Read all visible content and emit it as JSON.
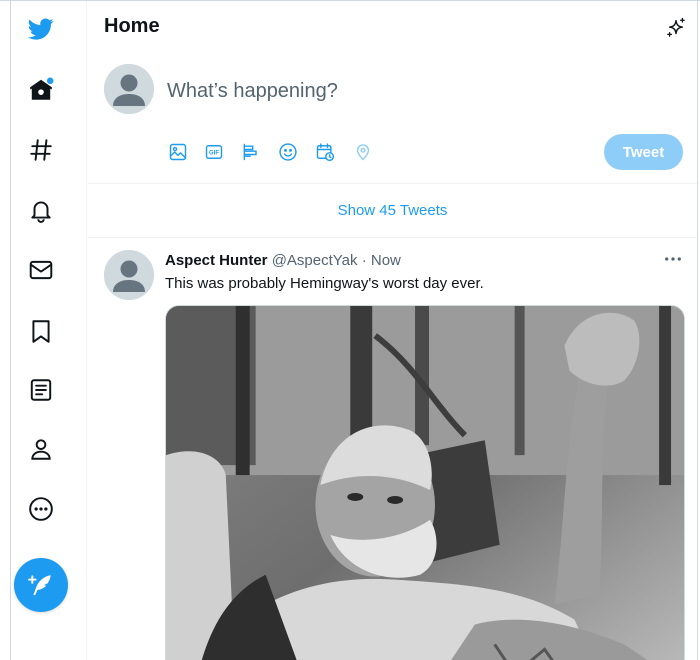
{
  "header": {
    "title": "Home"
  },
  "sidebar": {
    "items": [
      {
        "icon": "twitter-logo-icon"
      },
      {
        "icon": "home-icon",
        "has_notification_dot": true
      },
      {
        "icon": "explore-hashtag-icon"
      },
      {
        "icon": "notifications-bell-icon"
      },
      {
        "icon": "messages-envelope-icon"
      },
      {
        "icon": "bookmarks-icon"
      },
      {
        "icon": "lists-icon"
      },
      {
        "icon": "profile-icon"
      },
      {
        "icon": "more-ellipsis-icon"
      }
    ],
    "compose_icon": "compose-tweet-feather-icon"
  },
  "composer": {
    "placeholder": "What’s happening?",
    "tools": [
      "media-image-icon",
      "gif-icon",
      "poll-icon",
      "emoji-icon",
      "schedule-icon",
      "location-icon"
    ],
    "gif_label": "GIF",
    "tweet_button": "Tweet"
  },
  "timeline": {
    "show_more": "Show 45 Tweets"
  },
  "tweet": {
    "author_name": "Aspect Hunter",
    "author_handle": "@AspectYak",
    "separator": "·",
    "time": "Now",
    "text": "This was probably Hemingway's worst day ever.",
    "image_description_icon": "photo-image",
    "more_icon": "more-horizontal-icon"
  },
  "colors": {
    "accent": "#1d9bf0",
    "tweet_button_disabled": "#8ecdf7",
    "text_primary": "#0f1419",
    "text_secondary": "#536471",
    "border": "#eff3f4"
  }
}
